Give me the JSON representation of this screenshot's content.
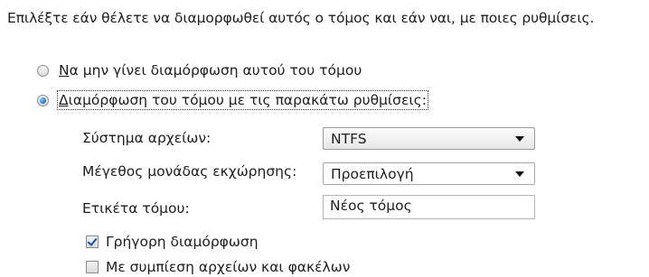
{
  "instruction": "Επιλέξτε εάν θέλετε να διαμορφωθεί αυτός ο τόμος και εάν ναι, με ποιες ρυθμίσεις.",
  "radio_no_format": {
    "accel": "Ν",
    "rest": "α μην γίνει διαμόρφωση αυτού του τόμου",
    "checked": false
  },
  "radio_format": {
    "accel": "Δ",
    "rest": "ιαμόρφωση του τόμου με τις παρακάτω ρυθμίσεις:",
    "checked": true
  },
  "file_system": {
    "label": "Σύστημα αρχείων:",
    "value": "NTFS"
  },
  "allocation_unit": {
    "label": "Μέγεθος μονάδας εκχώρησης:",
    "value": "Προεπιλογή"
  },
  "volume_label": {
    "label": "Ετικέτα τόμου:",
    "value": "Νέος τόμος"
  },
  "quick_format": {
    "label": "Γρήγορη διαμόρφωση",
    "checked": true
  },
  "compression": {
    "label": "Με συμπίεση αρχείων και φακέλων",
    "checked": false
  }
}
